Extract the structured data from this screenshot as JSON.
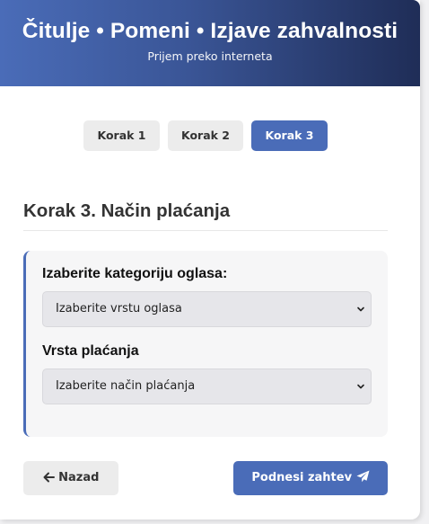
{
  "header": {
    "title": "Čitulje • Pomeni • Izjave zahvalnosti",
    "subtitle": "Prijem preko interneta"
  },
  "steps": [
    {
      "label": "Korak 1",
      "active": false
    },
    {
      "label": "Korak 2",
      "active": false
    },
    {
      "label": "Korak 3",
      "active": true
    }
  ],
  "section": {
    "title": "Korak 3. Način plaćanja"
  },
  "form": {
    "category_label": "Izaberite kategoriju oglasa:",
    "category_select": "Izaberite vrstu oglasa",
    "payment_label": "Vrsta plaćanja",
    "payment_select": "Izaberite način plaćanja"
  },
  "buttons": {
    "back_label": "Nazad",
    "submit_label": "Podnesi zahtev"
  },
  "icons": {
    "back": "arrow-left-icon",
    "submit": "paper-plane-icon",
    "select": "chevron-down-icon"
  },
  "colors": {
    "accent": "#4a6cb8",
    "header_dark": "#1f2d57"
  }
}
